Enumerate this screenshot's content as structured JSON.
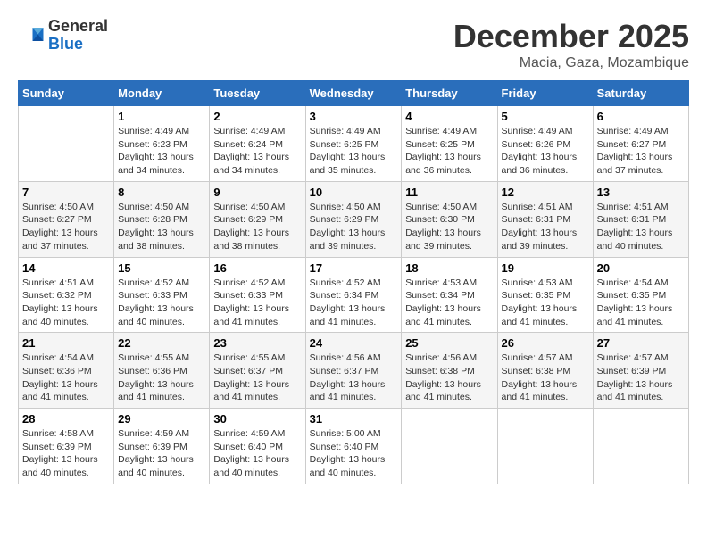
{
  "header": {
    "logo_general": "General",
    "logo_blue": "Blue",
    "month_year": "December 2025",
    "location": "Macia, Gaza, Mozambique"
  },
  "calendar": {
    "days_of_week": [
      "Sunday",
      "Monday",
      "Tuesday",
      "Wednesday",
      "Thursday",
      "Friday",
      "Saturday"
    ],
    "weeks": [
      [
        {
          "day": "",
          "info": ""
        },
        {
          "day": "1",
          "info": "Sunrise: 4:49 AM\nSunset: 6:23 PM\nDaylight: 13 hours\nand 34 minutes."
        },
        {
          "day": "2",
          "info": "Sunrise: 4:49 AM\nSunset: 6:24 PM\nDaylight: 13 hours\nand 34 minutes."
        },
        {
          "day": "3",
          "info": "Sunrise: 4:49 AM\nSunset: 6:25 PM\nDaylight: 13 hours\nand 35 minutes."
        },
        {
          "day": "4",
          "info": "Sunrise: 4:49 AM\nSunset: 6:25 PM\nDaylight: 13 hours\nand 36 minutes."
        },
        {
          "day": "5",
          "info": "Sunrise: 4:49 AM\nSunset: 6:26 PM\nDaylight: 13 hours\nand 36 minutes."
        },
        {
          "day": "6",
          "info": "Sunrise: 4:49 AM\nSunset: 6:27 PM\nDaylight: 13 hours\nand 37 minutes."
        }
      ],
      [
        {
          "day": "7",
          "info": "Sunrise: 4:50 AM\nSunset: 6:27 PM\nDaylight: 13 hours\nand 37 minutes."
        },
        {
          "day": "8",
          "info": "Sunrise: 4:50 AM\nSunset: 6:28 PM\nDaylight: 13 hours\nand 38 minutes."
        },
        {
          "day": "9",
          "info": "Sunrise: 4:50 AM\nSunset: 6:29 PM\nDaylight: 13 hours\nand 38 minutes."
        },
        {
          "day": "10",
          "info": "Sunrise: 4:50 AM\nSunset: 6:29 PM\nDaylight: 13 hours\nand 39 minutes."
        },
        {
          "day": "11",
          "info": "Sunrise: 4:50 AM\nSunset: 6:30 PM\nDaylight: 13 hours\nand 39 minutes."
        },
        {
          "day": "12",
          "info": "Sunrise: 4:51 AM\nSunset: 6:31 PM\nDaylight: 13 hours\nand 39 minutes."
        },
        {
          "day": "13",
          "info": "Sunrise: 4:51 AM\nSunset: 6:31 PM\nDaylight: 13 hours\nand 40 minutes."
        }
      ],
      [
        {
          "day": "14",
          "info": "Sunrise: 4:51 AM\nSunset: 6:32 PM\nDaylight: 13 hours\nand 40 minutes."
        },
        {
          "day": "15",
          "info": "Sunrise: 4:52 AM\nSunset: 6:33 PM\nDaylight: 13 hours\nand 40 minutes."
        },
        {
          "day": "16",
          "info": "Sunrise: 4:52 AM\nSunset: 6:33 PM\nDaylight: 13 hours\nand 41 minutes."
        },
        {
          "day": "17",
          "info": "Sunrise: 4:52 AM\nSunset: 6:34 PM\nDaylight: 13 hours\nand 41 minutes."
        },
        {
          "day": "18",
          "info": "Sunrise: 4:53 AM\nSunset: 6:34 PM\nDaylight: 13 hours\nand 41 minutes."
        },
        {
          "day": "19",
          "info": "Sunrise: 4:53 AM\nSunset: 6:35 PM\nDaylight: 13 hours\nand 41 minutes."
        },
        {
          "day": "20",
          "info": "Sunrise: 4:54 AM\nSunset: 6:35 PM\nDaylight: 13 hours\nand 41 minutes."
        }
      ],
      [
        {
          "day": "21",
          "info": "Sunrise: 4:54 AM\nSunset: 6:36 PM\nDaylight: 13 hours\nand 41 minutes."
        },
        {
          "day": "22",
          "info": "Sunrise: 4:55 AM\nSunset: 6:36 PM\nDaylight: 13 hours\nand 41 minutes."
        },
        {
          "day": "23",
          "info": "Sunrise: 4:55 AM\nSunset: 6:37 PM\nDaylight: 13 hours\nand 41 minutes."
        },
        {
          "day": "24",
          "info": "Sunrise: 4:56 AM\nSunset: 6:37 PM\nDaylight: 13 hours\nand 41 minutes."
        },
        {
          "day": "25",
          "info": "Sunrise: 4:56 AM\nSunset: 6:38 PM\nDaylight: 13 hours\nand 41 minutes."
        },
        {
          "day": "26",
          "info": "Sunrise: 4:57 AM\nSunset: 6:38 PM\nDaylight: 13 hours\nand 41 minutes."
        },
        {
          "day": "27",
          "info": "Sunrise: 4:57 AM\nSunset: 6:39 PM\nDaylight: 13 hours\nand 41 minutes."
        }
      ],
      [
        {
          "day": "28",
          "info": "Sunrise: 4:58 AM\nSunset: 6:39 PM\nDaylight: 13 hours\nand 40 minutes."
        },
        {
          "day": "29",
          "info": "Sunrise: 4:59 AM\nSunset: 6:39 PM\nDaylight: 13 hours\nand 40 minutes."
        },
        {
          "day": "30",
          "info": "Sunrise: 4:59 AM\nSunset: 6:40 PM\nDaylight: 13 hours\nand 40 minutes."
        },
        {
          "day": "31",
          "info": "Sunrise: 5:00 AM\nSunset: 6:40 PM\nDaylight: 13 hours\nand 40 minutes."
        },
        {
          "day": "",
          "info": ""
        },
        {
          "day": "",
          "info": ""
        },
        {
          "day": "",
          "info": ""
        }
      ]
    ]
  }
}
